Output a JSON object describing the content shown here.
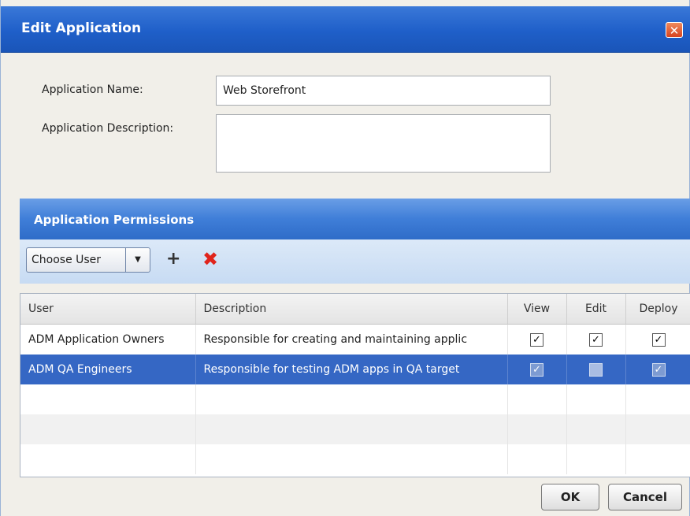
{
  "dialog": {
    "title": "Edit Application",
    "close_icon": "close-icon",
    "accent_color": "#2564cc"
  },
  "form": {
    "name_label": "Application Name:",
    "name_value": "Web Storefront",
    "description_label": "Application Description:",
    "description_value": ""
  },
  "permissions": {
    "header": "Application Permissions",
    "choose_user_label": "Choose User",
    "add_icon": "plus-icon",
    "delete_icon": "delete-x-icon",
    "columns": [
      "User",
      "Description",
      "View",
      "Edit",
      "Deploy"
    ],
    "rows": [
      {
        "user": "ADM Application Owners",
        "description": "Responsible for creating and maintaining applic",
        "view": "✓",
        "edit": "✓",
        "deploy": "✓",
        "selected": false
      },
      {
        "user": "ADM QA Engineers",
        "description": "Responsible for testing ADM apps in QA target",
        "view": "✓",
        "edit": "",
        "deploy": "✓",
        "selected": true
      }
    ],
    "selected_color": "#3567c4"
  },
  "buttons": {
    "ok": "OK",
    "cancel": "Cancel"
  }
}
